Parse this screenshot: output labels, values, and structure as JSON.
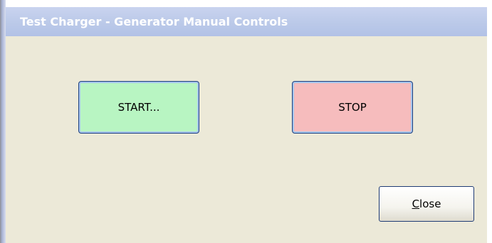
{
  "window": {
    "title": "Test Charger - Generator Manual Controls"
  },
  "buttons": {
    "start_label": "START...",
    "stop_label": "STOP",
    "close_label_first": "C",
    "close_label_rest": "lose"
  },
  "colors": {
    "start_bg": "#b8f5c2",
    "stop_bg": "#f6bcbd",
    "dialog_bg": "#ece9d8",
    "titlebar_bg": "#bccae9"
  }
}
